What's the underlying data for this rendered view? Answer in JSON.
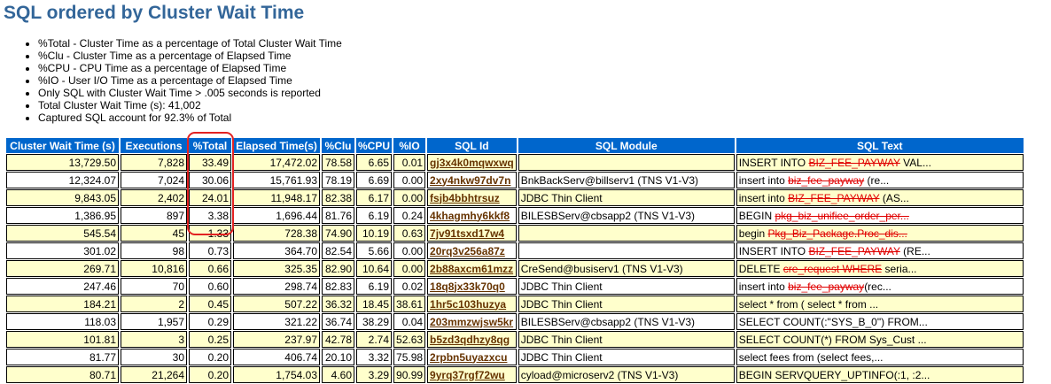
{
  "title": "SQL ordered by Cluster Wait Time",
  "notes": [
    "%Total - Cluster Time as a percentage of Total Cluster Wait Time",
    "%Clu - Cluster Time as a percentage of Elapsed Time",
    "%CPU - CPU Time as a percentage of Elapsed Time",
    "%IO - User I/O Time as a percentage of Elapsed Time",
    "Only SQL with Cluster Wait Time > .005 seconds is reported",
    "Total Cluster Wait Time (s): 41,002",
    "Captured SQL account for 92.3% of Total"
  ],
  "table": {
    "headers": [
      "Cluster Wait Time (s)",
      "Executions",
      "%Total",
      "Elapsed Time(s)",
      "%Clu",
      "%CPU",
      "%IO",
      "SQL Id",
      "SQL Module",
      "SQL Text"
    ],
    "rows": [
      {
        "cwt": "13,729.50",
        "exec": "7,828",
        "total": "33.49",
        "elapsed": "17,472.02",
        "clu": "78.58",
        "cpu": "6.65",
        "io": "0.01",
        "sqlid": "gj3x4k0mqwxwq",
        "module": "",
        "text_pre": "INSERT INTO ",
        "text_red": "BIZ_FEE_PAYWAY",
        "text_post": " VAL..."
      },
      {
        "cwt": "12,324.07",
        "exec": "7,024",
        "total": "30.06",
        "elapsed": "15,761.93",
        "clu": "78.19",
        "cpu": "6.69",
        "io": "0.00",
        "sqlid": "2xy4nkw97dv7n",
        "module": "BnkBackServ@billserv1 (TNS V1-V3)",
        "text_pre": "insert into ",
        "text_red": "biz_fee_payway",
        "text_post": " (re..."
      },
      {
        "cwt": "9,843.05",
        "exec": "2,402",
        "total": "24.01",
        "elapsed": "11,948.17",
        "clu": "82.38",
        "cpu": "6.17",
        "io": "0.00",
        "sqlid": "fsjb4bbhtrsuz",
        "module": "JDBC Thin Client",
        "text_pre": "insert into ",
        "text_red": "BIZ_FEE_PAYWAY",
        "text_post": " (AS..."
      },
      {
        "cwt": "1,386.95",
        "exec": "897",
        "total": "3.38",
        "elapsed": "1,696.44",
        "clu": "81.76",
        "cpu": "6.19",
        "io": "0.24",
        "sqlid": "4khagmhy6kkf8",
        "module": "BILESBServ@cbsapp2 (TNS V1-V3)",
        "text_pre": "BEGIN ",
        "text_red": "pkg_biz_unifiee_order_per...",
        "text_post": ""
      },
      {
        "cwt": "545.54",
        "exec": "45",
        "total": "1.33",
        "elapsed": "728.38",
        "clu": "74.90",
        "cpu": "10.19",
        "io": "0.63",
        "sqlid": "7jv91tsxd17w4",
        "module": "",
        "text_pre": "begin ",
        "text_red": "Pkg_Biz_Package.Proc_dis...",
        "text_post": ""
      },
      {
        "cwt": "301.02",
        "exec": "98",
        "total": "0.73",
        "elapsed": "364.70",
        "clu": "82.54",
        "cpu": "5.66",
        "io": "0.00",
        "sqlid": "20rq3v256a87z",
        "module": "",
        "text_pre": "INSERT INTO ",
        "text_red": "BIZ_FEE_PAYWAY",
        "text_post": " (RE..."
      },
      {
        "cwt": "269.71",
        "exec": "10,816",
        "total": "0.66",
        "elapsed": "325.35",
        "clu": "82.90",
        "cpu": "10.64",
        "io": "0.00",
        "sqlid": "2b88axcm61mzz",
        "module": "CreSend@busiserv1 (TNS V1-V3)",
        "text_pre": "DELETE ",
        "text_red": "cre_request WHERE",
        "text_post": " seria..."
      },
      {
        "cwt": "247.46",
        "exec": "70",
        "total": "0.60",
        "elapsed": "298.74",
        "clu": "82.83",
        "cpu": "6.19",
        "io": "0.02",
        "sqlid": "18q8jx33k70q0",
        "module": "JDBC Thin Client",
        "text_pre": "insert into ",
        "text_red": "biz_fee_payway",
        "text_post": "(rec..."
      },
      {
        "cwt": "184.21",
        "exec": "2",
        "total": "0.45",
        "elapsed": "507.22",
        "clu": "36.32",
        "cpu": "18.45",
        "io": "38.61",
        "sqlid": "1hr5c103huzya",
        "module": "JDBC Thin Client",
        "text_pre": "select * from ( select * from ...",
        "text_red": "",
        "text_post": ""
      },
      {
        "cwt": "118.03",
        "exec": "1,957",
        "total": "0.29",
        "elapsed": "321.22",
        "clu": "36.74",
        "cpu": "38.29",
        "io": "0.04",
        "sqlid": "203mmzwjsw5kr",
        "module": "BILESBServ@cbsapp2 (TNS V1-V3)",
        "text_pre": "SELECT COUNT(:\"SYS_B_0\") FROM...",
        "text_red": "",
        "text_post": ""
      },
      {
        "cwt": "101.81",
        "exec": "3",
        "total": "0.25",
        "elapsed": "237.97",
        "clu": "42.78",
        "cpu": "2.74",
        "io": "52.63",
        "sqlid": "b5zd3qdhzy8qg",
        "module": "JDBC Thin Client",
        "text_pre": "SELECT COUNT(*) FROM Sys_Cust ...",
        "text_red": "",
        "text_post": ""
      },
      {
        "cwt": "81.77",
        "exec": "30",
        "total": "0.20",
        "elapsed": "406.74",
        "clu": "20.10",
        "cpu": "3.32",
        "io": "75.98",
        "sqlid": "2rpbn5uyazxcu",
        "module": "JDBC Thin Client",
        "text_pre": "select fees from (select fees,...",
        "text_red": "",
        "text_post": ""
      },
      {
        "cwt": "80.71",
        "exec": "21,264",
        "total": "0.20",
        "elapsed": "1,754.03",
        "clu": "4.60",
        "cpu": "3.29",
        "io": "90.99",
        "sqlid": "9yrq37rgf72wu",
        "module": "cyload@microserv2 (TNS V1-V3)",
        "text_pre": "BEGIN SERVQUERY_UPTINFO(:1, :2...",
        "text_red": "",
        "text_post": ""
      }
    ]
  },
  "colors": {
    "title": "#336699",
    "header_bg": "#0066cc",
    "row_odd": "#ffffcc",
    "row_even": "#ffffff",
    "sqlid_link": "#663300",
    "annotation": "#e22222"
  }
}
